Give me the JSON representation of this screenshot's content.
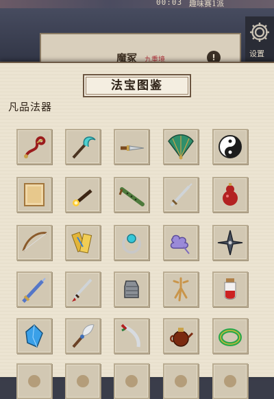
{
  "topbar": {
    "timer": "00:03",
    "subtitle": "趣味赛1派"
  },
  "realm": {
    "name": "魔冢",
    "level": "九重境",
    "button_label": "!"
  },
  "settings": {
    "label": "设置",
    "icon": "gear-icon"
  },
  "panel": {
    "title": "法宝图鉴",
    "section_label": "凡品法器"
  },
  "items": [
    {
      "icon": "red-ribbon-whip-icon"
    },
    {
      "icon": "jade-hook-blade-icon"
    },
    {
      "icon": "throwing-dagger-icon"
    },
    {
      "icon": "folding-fan-icon"
    },
    {
      "icon": "yin-yang-icon"
    },
    {
      "icon": "paper-scroll-icon"
    },
    {
      "icon": "flaming-torch-icon"
    },
    {
      "icon": "bamboo-flute-icon"
    },
    {
      "icon": "steel-sword-icon"
    },
    {
      "icon": "red-gourd-icon"
    },
    {
      "icon": "long-bow-icon"
    },
    {
      "icon": "golden-talismans-icon"
    },
    {
      "icon": "jade-ring-icon"
    },
    {
      "icon": "purple-cloud-charm-icon"
    },
    {
      "icon": "shuriken-icon"
    },
    {
      "icon": "blue-sword-icon"
    },
    {
      "icon": "red-tassel-dagger-icon"
    },
    {
      "icon": "iron-gauntlet-icon"
    },
    {
      "icon": "ginseng-root-icon"
    },
    {
      "icon": "potion-vial-icon"
    },
    {
      "icon": "spirit-crystal-icon"
    },
    {
      "icon": "feather-duster-icon"
    },
    {
      "icon": "curved-sabre-icon"
    },
    {
      "icon": "bronze-teapot-icon"
    },
    {
      "icon": "jade-bracelet-icon"
    },
    {
      "icon": "partial-item-icon"
    },
    {
      "icon": "partial-item-icon"
    },
    {
      "icon": "partial-item-icon"
    },
    {
      "icon": "partial-item-icon"
    },
    {
      "icon": "partial-item-icon"
    }
  ]
}
